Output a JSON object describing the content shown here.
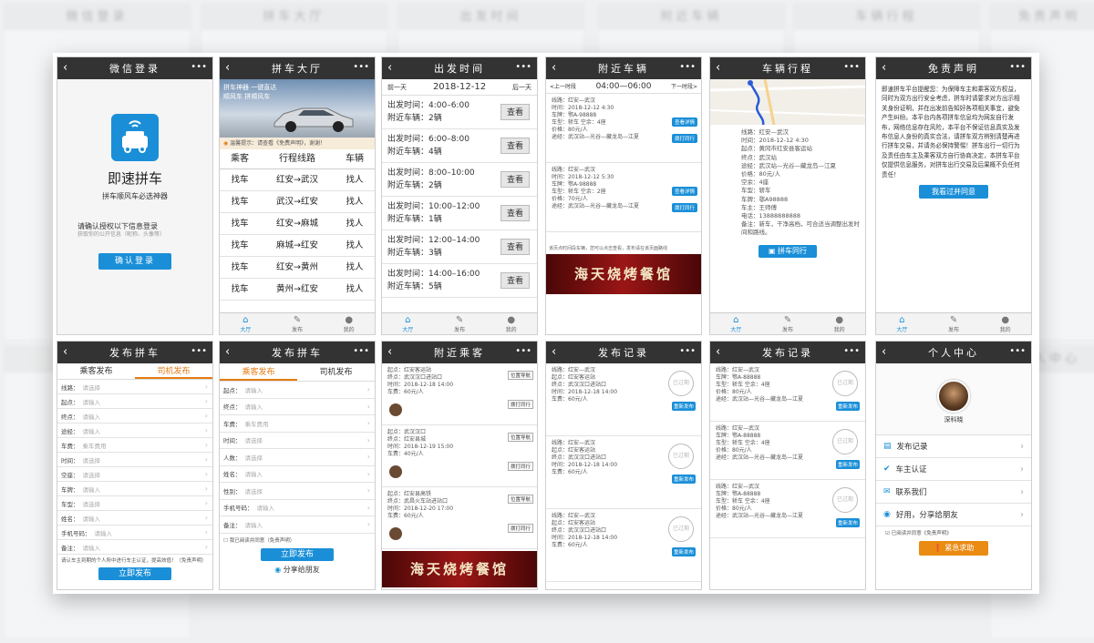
{
  "screens": {
    "login": {
      "title": "微信登录",
      "app_name": "即速拼车",
      "slogan": "拼车顺风车必选神器",
      "auth_prompt": "请确认授权以下信息登录",
      "auth_desc": "获取你的公开信息（昵称、头像等）",
      "login_button": "确认登录"
    },
    "hall": {
      "title": "拼车大厅",
      "banner_line1": "拼车神器   一键直达",
      "banner_line2": "顺风车   拼顺风车",
      "notice": "温馨提示：请查看《免费声明》，谢谢！",
      "columns": [
        "乘客",
        "行程线路",
        "车辆"
      ],
      "rows": [
        [
          "找车",
          "红安→武汉",
          "找人"
        ],
        [
          "找车",
          "武汉→红安",
          "找人"
        ],
        [
          "找车",
          "红安→麻城",
          "找人"
        ],
        [
          "找车",
          "麻城→红安",
          "找人"
        ],
        [
          "找车",
          "红安→黄州",
          "找人"
        ],
        [
          "找车",
          "黄州→红安",
          "找人"
        ]
      ]
    },
    "depart": {
      "title": "出发时间",
      "prev": "前一天",
      "date": "2018-12-12",
      "next": "后一天",
      "check_label": "查看",
      "slots": [
        {
          "time": "出发时间：4:00–6:00",
          "count": "附近车辆：2辆"
        },
        {
          "time": "出发时间：6:00–8:00",
          "count": "附近车辆：4辆"
        },
        {
          "time": "出发时间：8:00–10:00",
          "count": "附近车辆：2辆"
        },
        {
          "time": "出发时间：10:00–12:00",
          "count": "附近车辆：1辆"
        },
        {
          "time": "出发时间：12:00–14:00",
          "count": "附近车辆：3辆"
        },
        {
          "time": "出发时间：14:00–16:00",
          "count": "附近车辆：5辆"
        }
      ]
    },
    "nearby": {
      "title": "附近车辆",
      "prev": "<上一时段",
      "range": "04:00—06:00",
      "next": "下一时段>",
      "detail_btn": "查看详情",
      "phone_btn": "拨打同行",
      "note": "该页点时间段车辆，您可以点击查看，发布请在该页面路线",
      "items": [
        [
          "线路：红安—武汉",
          "时间：2018-12-12 4:30",
          "车牌：鄂A-98888",
          "车型：轿车   空余：4座",
          "价格：80元/人",
          "途经：武汉站—光谷—藏龙岛—江夏"
        ],
        [
          "线路：红安—武汉",
          "时间：2018-12-12 5:30",
          "车牌：鄂A-98888",
          "车型：轿车   空余：2座",
          "价格：70元/人",
          "途经：武汉站—光谷—藏龙岛—江夏"
        ]
      ]
    },
    "trip": {
      "title": "车辆行程",
      "details": [
        "线路：红安—武汉",
        "时间：2018-12-12 4:30",
        "起点：黄冈市红安县客运站",
        "终点：武汉站",
        "途经：武汉站—光谷—藏龙岛—江夏",
        "价格：80元/人",
        "空余：4座",
        "车型：轿车",
        "车牌：鄂A98888",
        "车主：王师傅",
        "电话：13888888888",
        "备注：新车，干净高档，可合适当调整出发时间和路线。"
      ],
      "button": "拼车同行"
    },
    "disclaimer": {
      "title": "免责声明",
      "text": "即速拼车平台提醒您：为保障车主和乘客双方权益，同时为双方出行安全考虑，拼车时请要求对方出示相关身份证明，并在出发前告知好各项相关事宜，避免产生纠纷。本平台内各项拼车信息均为网友自行发布，网络信息存在风险，本平台不保证信息真实及发布信息人身份的真实合法，请拼车双方辨别清楚再进行拼车交易，并请务必保持警惕！拼车出行一切行为及责任由车主及乘客双方自行协商决定，本拼车平台仅提供信息服务，对拼车出行交易及后果概不负任何责任！",
      "agree_button": "我看过并同意"
    },
    "publish1": {
      "title": "发布拼车",
      "tab_passenger": "乘客发布",
      "tab_driver": "司机发布",
      "fields": [
        [
          "线路：",
          "请选择"
        ],
        [
          "起点：",
          "请输入"
        ],
        [
          "终点：",
          "请输入"
        ],
        [
          "途经：",
          "请输入"
        ],
        [
          "车费：",
          "乘车费用"
        ],
        [
          "时间：",
          "请选择"
        ],
        [
          "空座：",
          "请选择"
        ],
        [
          "车牌：",
          "请输入"
        ],
        [
          "车型：",
          "请选择"
        ],
        [
          "姓名：",
          "请输入"
        ],
        [
          "手机号码：",
          "请输入"
        ],
        [
          "备注：",
          "请输入"
        ]
      ],
      "agree": "请认车主到期的个人所中进行车主认证，提高效值！（免责声明）",
      "submit": "立即发布"
    },
    "publish2": {
      "title": "发布拼车",
      "tab_passenger": "乘客发布",
      "tab_driver": "司机发布",
      "fields": [
        [
          "起点：",
          "请输入"
        ],
        [
          "终点：",
          "请输入"
        ],
        [
          "车费：",
          "乘车费用"
        ],
        [
          "时间：",
          "请选择"
        ],
        [
          "人数：",
          "请选择"
        ],
        [
          "姓名：",
          "请输入"
        ],
        [
          "性别：",
          "请选择"
        ],
        [
          "手机号码：",
          "请输入"
        ],
        [
          "备注：",
          "请输入"
        ]
      ],
      "agree": "我已阅读并同意（免责声明）",
      "submit": "立即发布",
      "share": "分享给朋友"
    },
    "passengers": {
      "title": "附近乘客",
      "loc_btn": "位置导航",
      "call_btn": "拨打同行",
      "items": [
        [
          "起点：红安客运站",
          "终点：武汉汉口进站口",
          "时间：2018-12-18 14:00",
          "车费：60元/人"
        ],
        [
          "起点：武汉汉口",
          "终点：红安县城",
          "时间：2018-12-19 15:00",
          "车费：40元/人"
        ],
        [
          "起点：红安县高铁",
          "终点：武昌火车站进站口",
          "时间：2018-12-20 17:00",
          "车费：60元/人"
        ]
      ],
      "banner": "海天烧烤餐馆"
    },
    "records1": {
      "title": "发布记录",
      "stamp": "已过期",
      "republish": "重新发布",
      "items": [
        [
          "线路：红安—武汉",
          "起点：红安客运站",
          "终点：武汉汉口进站口",
          "时间：2018-12-18 14:00",
          "车费：60元/人"
        ],
        [
          "线路：红安—武汉",
          "起点：红安客运站",
          "终点：武汉汉口进站口",
          "时间：2018-12-18 14:00",
          "车费：60元/人"
        ],
        [
          "线路：红安—武汉",
          "起点：红安客运站",
          "终点：武汉汉口进站口",
          "时间：2018-12-18 14:00",
          "车费：60元/人"
        ]
      ]
    },
    "records2": {
      "title": "发布记录",
      "stamp": "已过期",
      "republish": "重新发布",
      "items": [
        [
          "线路：红安—武汉",
          "车牌：鄂A-88888",
          "车型：轿车   空余：4座",
          "价格：80元/人",
          "途经：武汉站—光谷—藏龙岛—江夏"
        ],
        [
          "线路：红安—武汉",
          "车牌：鄂A-88888",
          "车型：轿车   空余：4座",
          "价格：80元/人",
          "途经：武汉站—光谷—藏龙岛—江夏"
        ],
        [
          "线路：红安—武汉",
          "车牌：鄂A-88888",
          "车型：轿车   空余：4座",
          "价格：80元/人",
          "途经：武汉站—光谷—藏龙岛—江夏"
        ]
      ]
    },
    "profile": {
      "title": "个人中心",
      "username": "深科晓",
      "menu": [
        "发布记录",
        "车主认证",
        "联系我们",
        "好用，分享给朋友"
      ],
      "agree": "已阅读并同意《免责声明》",
      "sos": "紧急求助"
    }
  },
  "tabbar": {
    "home": "大厅",
    "publish": "发布",
    "me": "我的"
  },
  "banner_text": "海天烧烤餐馆",
  "colors": {
    "header": "#333333",
    "accent": "#1a8fd8",
    "sos": "#ea8b14",
    "banner": "#9b1616"
  }
}
